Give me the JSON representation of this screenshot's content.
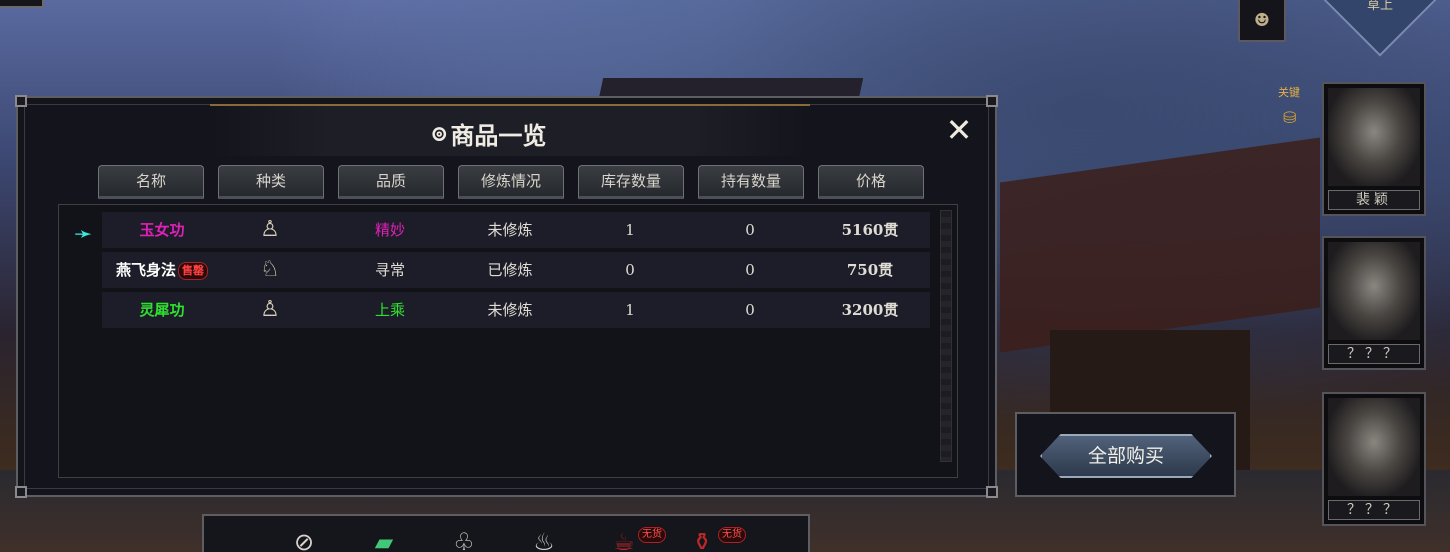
{
  "top_right": {
    "rank_label": "草上",
    "emblem_icon": "cat-face-icon"
  },
  "key_tag": "关键",
  "portraits": [
    {
      "name": "裴颖"
    },
    {
      "name": "？？？"
    },
    {
      "name": "？？？"
    }
  ],
  "panel": {
    "title": "商品一览",
    "title_icon": "coin-icon",
    "close_label": "✕",
    "headers": [
      "名称",
      "种类",
      "品质",
      "修炼情况",
      "库存数量",
      "持有数量",
      "价格"
    ],
    "rows": [
      {
        "name": "玉女功",
        "name_color": "#e020b8",
        "type_icon": "meditation-figure-icon",
        "quality": "精妙",
        "quality_color": "#e020b8",
        "status": "未修炼",
        "stock": "1",
        "held": "0",
        "price": "5160贯",
        "selected": true
      },
      {
        "name": "燕飞身法",
        "name_color": "#ffffff",
        "badge": "售罄",
        "type_icon": "movement-figure-icon",
        "quality": "寻常",
        "quality_color": "#e0dcd4",
        "status": "已修炼",
        "stock": "0",
        "held": "0",
        "price": "750贯",
        "selected": false
      },
      {
        "name": "灵犀功",
        "name_color": "#30e030",
        "type_icon": "meditation-figure-icon",
        "quality": "上乘",
        "quality_color": "#30e030",
        "status": "未修炼",
        "stock": "1",
        "held": "0",
        "price": "3200贯",
        "selected": false
      }
    ]
  },
  "buy_all_label": "全部购买",
  "toolbar": {
    "badges": [
      "无货",
      "无货"
    ],
    "icons": [
      "no-eating-icon",
      "cards-icon",
      "medicine-bag-icon",
      "steam-bath-icon",
      "teapot-icon",
      "wine-jar-icon"
    ]
  }
}
